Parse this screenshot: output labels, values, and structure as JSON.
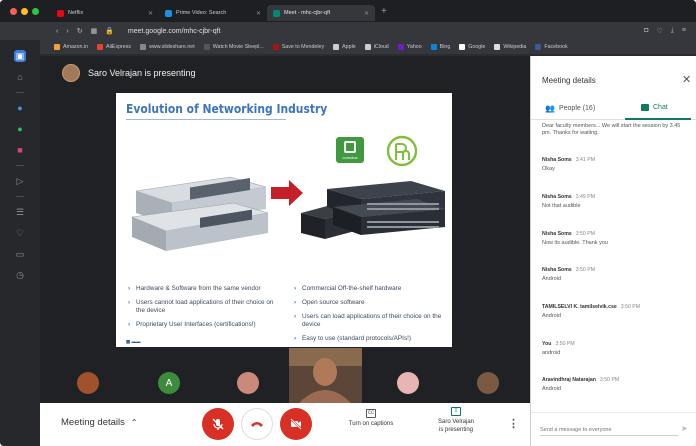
{
  "browser": {
    "tabs": [
      {
        "label": "Netflix",
        "color": "#e50914",
        "active": false
      },
      {
        "label": "Prime Video: Search",
        "color": "#1f8fe0",
        "active": false
      },
      {
        "label": "Meet - mhc-cjbr-qft",
        "color": "#00897b",
        "active": true
      }
    ],
    "url": "meet.google.com/mhc-cjbr-qft",
    "bookmarks": [
      {
        "label": "Amazon.in",
        "color": "#f0a23b"
      },
      {
        "label": "AliExpress",
        "color": "#e6452b"
      },
      {
        "label": "www.slideshare.net",
        "color": "#888"
      },
      {
        "label": "Watch Movie Sleepl...",
        "color": "#555"
      },
      {
        "label": "Save to Mendeley",
        "color": "#a11"
      },
      {
        "label": "Apple",
        "color": "#ccc"
      },
      {
        "label": "iCloud",
        "color": "#ccc"
      },
      {
        "label": "Yahoo",
        "color": "#6a1fc2"
      },
      {
        "label": "Bing",
        "color": "#0a86d8"
      },
      {
        "label": "Google",
        "color": "#fff"
      },
      {
        "label": "Wikipedia",
        "color": "#ddd"
      },
      {
        "label": "Facebook",
        "color": "#3b5998"
      }
    ]
  },
  "meet": {
    "presenter_text": "Saro Velrajan is presenting",
    "slide": {
      "title": "Evolution of Networking Industry",
      "logo_text": "cumulus",
      "left_bullets": [
        "Hardware & Software from the same vendor",
        "Users cannot load applications of their choice on the device",
        "Proprietary User Interfaces (certifications!)"
      ],
      "right_bullets": [
        "Commercial Off-the-shelf hardware",
        "Open source software",
        "Users can load applications of their choice on the device",
        "Easy to use (standard protocols/APIs!)"
      ]
    },
    "participants": [
      {
        "initial": "",
        "color": "#a0522d"
      },
      {
        "initial": "A",
        "color": "#3d8b3d"
      },
      {
        "initial": "",
        "color": "#c98a7a"
      },
      {
        "initial": "",
        "color": "#e8b4b4"
      },
      {
        "initial": "",
        "color": "#7a5a40"
      }
    ],
    "controls": {
      "meeting_details": "Meeting details",
      "captions_label": "Turn on captions",
      "present_label_line1": "Saro Velrajan",
      "present_label_line2": "is presenting"
    }
  },
  "panel": {
    "title": "Meeting details",
    "people_tab": "People (16)",
    "chat_tab": "Chat",
    "messages": [
      {
        "sender": "",
        "time": "",
        "text": "Dear faculty members... We will start the session by 3.45 pm. Thanks for waiting."
      },
      {
        "sender": "Nisha Soms",
        "time": "3:41 PM",
        "text": "Okay"
      },
      {
        "sender": "Nisha Soms",
        "time": "3:49 PM",
        "text": "Not that audible"
      },
      {
        "sender": "Nisha Soms",
        "time": "3:50 PM",
        "text": "Now its audible. Thank you"
      },
      {
        "sender": "Nisha Soms",
        "time": "3:50 PM",
        "text": "Android"
      },
      {
        "sender": "TAMILSELVI K. tamilselvik.cse",
        "time": "3:50 PM",
        "text": "Android"
      },
      {
        "sender": "You",
        "time": "3:50 PM",
        "text": "android"
      },
      {
        "sender": "Aravindhraj Natarajan",
        "time": "3:50 PM",
        "text": "Android"
      }
    ],
    "input_placeholder": "Send a message to everyone"
  },
  "colors": {
    "accent": "#0f7a62",
    "mic_off": "#d93025",
    "slide_title": "#3c74c0"
  }
}
